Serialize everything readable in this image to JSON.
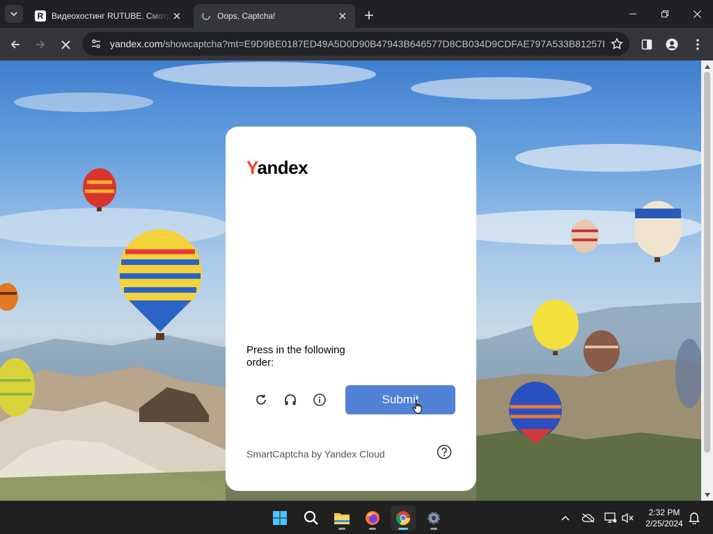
{
  "browser": {
    "tabs": [
      {
        "title": "Видеохостинг RUTUBE. Смотрите",
        "favicon": "R",
        "active": false
      },
      {
        "title": "Oops, Captcha!",
        "active": true
      }
    ],
    "address": {
      "host": "yandex.com",
      "path": "/showcaptcha?mt=E9D9BE0187ED49A5D0D90B47943B646577D8CB034D9CDFAE797A533B81257E0C..."
    }
  },
  "captcha": {
    "logo_first": "Y",
    "logo_rest": "andex",
    "prompt": "Press in the following order:",
    "submit_label": "Submit",
    "branding": "SmartCaptcha by Yandex Cloud"
  },
  "taskbar": {
    "time": "2:32 PM",
    "date": "2/25/2024"
  },
  "colors": {
    "yandex_red": "#fc3f1d",
    "submit_blue": "#5282d6",
    "chrome_dark": "#202124",
    "chrome_toolbar": "#35363a"
  }
}
